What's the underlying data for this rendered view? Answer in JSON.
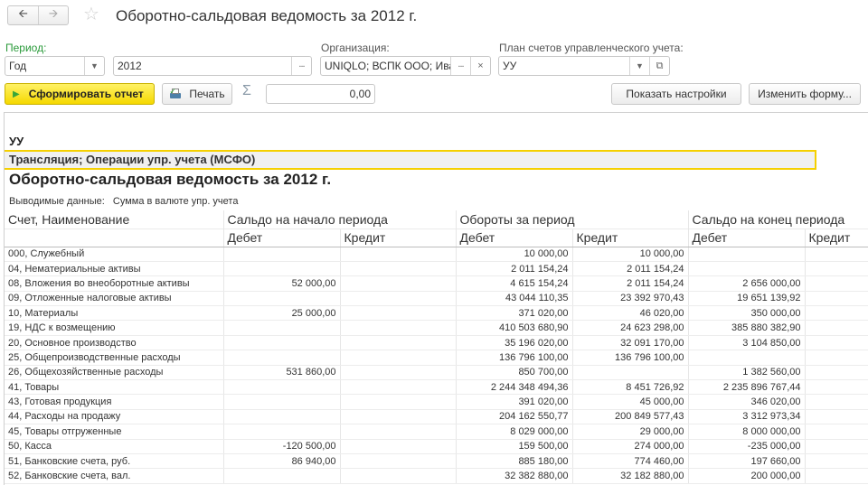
{
  "window": {
    "title": "Оборотно-сальдовая ведомость за 2012 г.",
    "back_icon": "arrow-left",
    "forward_icon": "arrow-right",
    "favorite_icon": "star"
  },
  "filters": {
    "period_label": "Период:",
    "period_type": "Год",
    "period_value": "2012",
    "organization_label": "Организация:",
    "organization_value": "UNIQLO; ВСПК ООО; Ива",
    "chart_of_accounts_label": "План счетов управленческого учета:",
    "chart_of_accounts_value": "УУ"
  },
  "toolbar": {
    "generate_label": "Сформировать отчет",
    "print_label": "Печать",
    "sum_symbol": "Σ",
    "sum_value": "0,00",
    "show_settings_label": "Показать настройки",
    "change_form_label": "Изменить форму..."
  },
  "report": {
    "chart_name": "УУ",
    "filter_line": "Трансляция; Операции упр. учета (МСФО)",
    "title": "Оборотно-сальдовая ведомость за 2012 г.",
    "output_label": "Выводимые данные:",
    "output_value": "Сумма в валюте упр. учета",
    "headers": {
      "account": "Счет, Наименование",
      "opening": "Сальдо на начало периода",
      "turnover": "Обороты за период",
      "closing": "Сальдо на конец периода",
      "debit": "Дебет",
      "credit": "Кредит"
    },
    "rows": [
      {
        "account": "000, Служебный",
        "open_dt": "",
        "open_ct": "",
        "turn_dt": "10 000,00",
        "turn_ct": "10 000,00",
        "close_dt": "",
        "close_ct": ""
      },
      {
        "account": "04, Нематериальные активы",
        "open_dt": "",
        "open_ct": "",
        "turn_dt": "2 011 154,24",
        "turn_ct": "2 011 154,24",
        "close_dt": "",
        "close_ct": ""
      },
      {
        "account": "08, Вложения во внеоборотные активы",
        "open_dt": "52 000,00",
        "open_ct": "",
        "turn_dt": "4 615 154,24",
        "turn_ct": "2 011 154,24",
        "close_dt": "2 656 000,00",
        "close_ct": ""
      },
      {
        "account": "09, Отложенные налоговые активы",
        "open_dt": "",
        "open_ct": "",
        "turn_dt": "43 044 110,35",
        "turn_ct": "23 392 970,43",
        "close_dt": "19 651 139,92",
        "close_ct": ""
      },
      {
        "account": "10, Материалы",
        "open_dt": "25 000,00",
        "open_ct": "",
        "turn_dt": "371 020,00",
        "turn_ct": "46 020,00",
        "close_dt": "350 000,00",
        "close_ct": ""
      },
      {
        "account": "19, НДС к возмещению",
        "open_dt": "",
        "open_ct": "",
        "turn_dt": "410 503 680,90",
        "turn_ct": "24 623 298,00",
        "close_dt": "385 880 382,90",
        "close_ct": ""
      },
      {
        "account": "20, Основное производство",
        "open_dt": "",
        "open_ct": "",
        "turn_dt": "35 196 020,00",
        "turn_ct": "32 091 170,00",
        "close_dt": "3 104 850,00",
        "close_ct": ""
      },
      {
        "account": "25, Общепроизводственные расходы",
        "open_dt": "",
        "open_ct": "",
        "turn_dt": "136 796 100,00",
        "turn_ct": "136 796 100,00",
        "close_dt": "",
        "close_ct": ""
      },
      {
        "account": "26, Общехозяйственные расходы",
        "open_dt": "531 860,00",
        "open_ct": "",
        "turn_dt": "850 700,00",
        "turn_ct": "",
        "close_dt": "1 382 560,00",
        "close_ct": ""
      },
      {
        "account": "41, Товары",
        "open_dt": "",
        "open_ct": "",
        "turn_dt": "2 244 348 494,36",
        "turn_ct": "8 451 726,92",
        "close_dt": "2 235 896 767,44",
        "close_ct": ""
      },
      {
        "account": "43, Готовая продукция",
        "open_dt": "",
        "open_ct": "",
        "turn_dt": "391 020,00",
        "turn_ct": "45 000,00",
        "close_dt": "346 020,00",
        "close_ct": ""
      },
      {
        "account": "44, Расходы на продажу",
        "open_dt": "",
        "open_ct": "",
        "turn_dt": "204 162 550,77",
        "turn_ct": "200 849 577,43",
        "close_dt": "3 312 973,34",
        "close_ct": ""
      },
      {
        "account": "45, Товары отгруженные",
        "open_dt": "",
        "open_ct": "",
        "turn_dt": "8 029 000,00",
        "turn_ct": "29 000,00",
        "close_dt": "8 000 000,00",
        "close_ct": ""
      },
      {
        "account": "50, Касса",
        "open_dt": "-120 500,00",
        "open_ct": "",
        "turn_dt": "159 500,00",
        "turn_ct": "274 000,00",
        "close_dt": "-235 000,00",
        "close_ct": ""
      },
      {
        "account": "51, Банковские счета, руб.",
        "open_dt": "86 940,00",
        "open_ct": "",
        "turn_dt": "885 180,00",
        "turn_ct": "774 460,00",
        "close_dt": "197 660,00",
        "close_ct": ""
      },
      {
        "account": "52, Банковские счета, вал.",
        "open_dt": "",
        "open_ct": "",
        "turn_dt": "32 382 880,00",
        "turn_ct": "32 182 880,00",
        "close_dt": "200 000,00",
        "close_ct": ""
      }
    ]
  }
}
